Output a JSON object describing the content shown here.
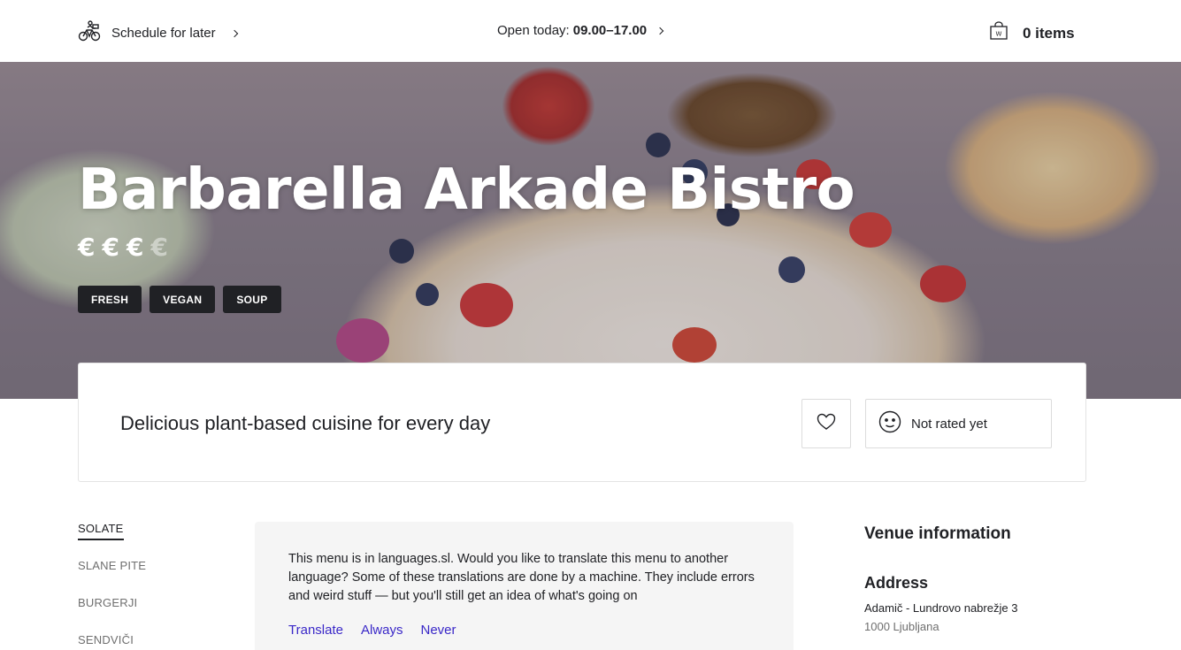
{
  "topbar": {
    "schedule_label": "Schedule for later",
    "schedule_icon": "bike-icon",
    "open_prefix": "Open today:",
    "open_hours": "09.00–17.00",
    "cart_count": "0 items",
    "cart_icon": "shopping-bag-icon"
  },
  "hero": {
    "title": "Barbarella Arkade Bistro",
    "price_level": 3,
    "price_max": 4,
    "price_symbol": "€",
    "tags": [
      "FRESH",
      "VEGAN",
      "SOUP"
    ]
  },
  "card": {
    "description": "Delicious plant-based cuisine for every day",
    "favorite_icon": "heart-icon",
    "rating_icon": "smiley-icon",
    "rating_label": "Not rated yet"
  },
  "categories": [
    {
      "label": "SOLATE",
      "active": true
    },
    {
      "label": "SLANE PITE",
      "active": false
    },
    {
      "label": "BURGERJI",
      "active": false
    },
    {
      "label": "SENDVIČI",
      "active": false
    }
  ],
  "translation": {
    "message": "This menu is in languages.sl. Would you like to translate this menu to another language? Some of these translations are done by a machine. They include errors and weird stuff — but you'll still get an idea of what's going on",
    "translate": "Translate",
    "always": "Always",
    "never": "Never"
  },
  "venue": {
    "heading": "Venue information",
    "address_heading": "Address",
    "address_line1": "Adamič - Lundrovo nabrežje 3",
    "address_line2": "1000 Ljubljana"
  }
}
